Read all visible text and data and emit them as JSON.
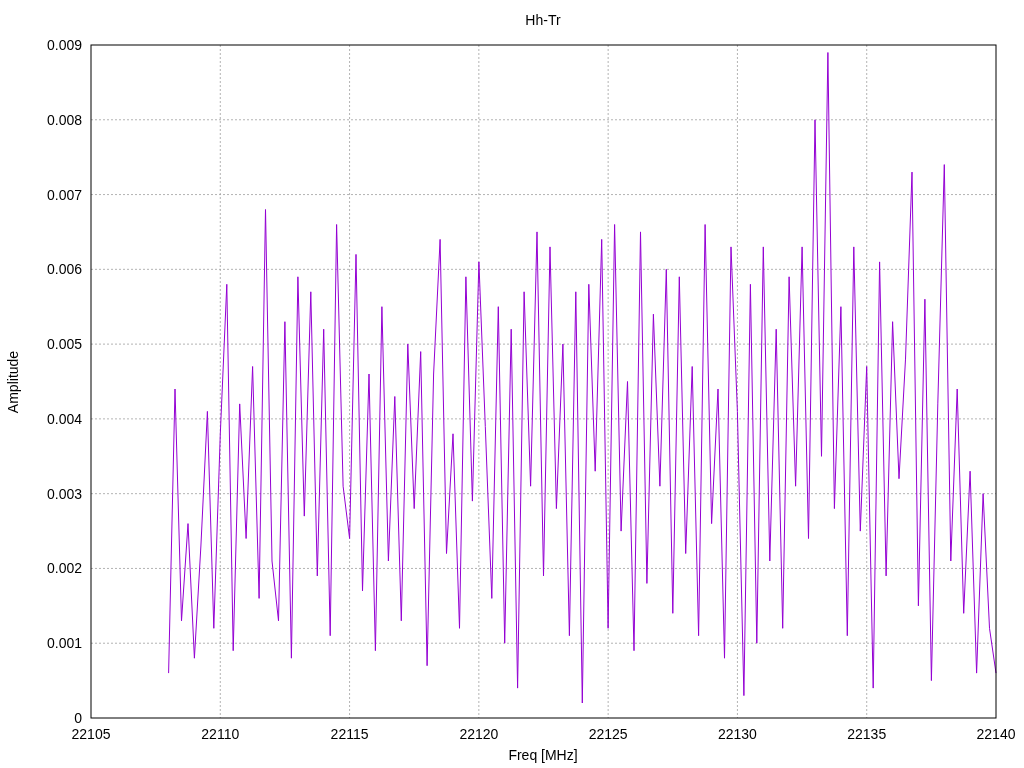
{
  "chart": {
    "chart_data": {
      "type": "line",
      "title": "Hh-Tr",
      "xlabel": "Freq [MHz]",
      "ylabel": "Amplitude",
      "grid": true,
      "xlim": [
        22105,
        22140
      ],
      "ylim": [
        0,
        0.009
      ],
      "xticks": [
        22105,
        22110,
        22115,
        22120,
        22125,
        22130,
        22135,
        22140
      ],
      "yticks": [
        0.009,
        0.008,
        0.007,
        0.006,
        0.005,
        0.004,
        0.003,
        0.002,
        0.001,
        0
      ],
      "x": [
        22108,
        22108.25,
        22108.5,
        22108.75,
        22109,
        22109.25,
        22109.5,
        22109.75,
        22110,
        22110.25,
        22110.5,
        22110.75,
        22111,
        22111.25,
        22111.5,
        22111.75,
        22112,
        22112.25,
        22112.5,
        22112.75,
        22113,
        22113.25,
        22113.5,
        22113.75,
        22114,
        22114.25,
        22114.5,
        22114.75,
        22115,
        22115.25,
        22115.5,
        22115.75,
        22116,
        22116.25,
        22116.5,
        22116.75,
        22117,
        22117.25,
        22117.5,
        22117.75,
        22118,
        22118.25,
        22118.5,
        22118.75,
        22119,
        22119.25,
        22119.5,
        22119.75,
        22120,
        22120.25,
        22120.5,
        22120.75,
        22121,
        22121.25,
        22121.5,
        22121.75,
        22122,
        22122.25,
        22122.5,
        22122.75,
        22123,
        22123.25,
        22123.5,
        22123.75,
        22124,
        22124.25,
        22124.5,
        22124.75,
        22125,
        22125.25,
        22125.5,
        22125.75,
        22126,
        22126.25,
        22126.5,
        22126.75,
        22127,
        22127.25,
        22127.5,
        22127.75,
        22128,
        22128.25,
        22128.5,
        22128.75,
        22129,
        22129.25,
        22129.5,
        22129.75,
        22130,
        22130.25,
        22130.5,
        22130.75,
        22131,
        22131.25,
        22131.5,
        22131.75,
        22132,
        22132.25,
        22132.5,
        22132.75,
        22133,
        22133.25,
        22133.5,
        22133.75,
        22134,
        22134.25,
        22134.5,
        22134.75,
        22135,
        22135.25,
        22135.5,
        22135.75,
        22136,
        22136.25,
        22136.5,
        22136.75,
        22137,
        22137.25,
        22137.5,
        22137.75,
        22138,
        22138.25,
        22138.5,
        22138.75,
        22139,
        22139.25,
        22139.5,
        22139.75,
        22140
      ],
      "series": [
        {
          "color": "#9400d3",
          "values": [
            0.0006,
            0.0044,
            0.0013,
            0.0026,
            0.0008,
            0.0023,
            0.0041,
            0.0012,
            0.0038,
            0.0058,
            0.0009,
            0.0042,
            0.0024,
            0.0047,
            0.0016,
            0.0068,
            0.0021,
            0.0013,
            0.0053,
            0.0008,
            0.0059,
            0.0027,
            0.0057,
            0.0019,
            0.0052,
            0.0011,
            0.0066,
            0.0031,
            0.0024,
            0.0062,
            0.0017,
            0.0046,
            0.0009,
            0.0055,
            0.0021,
            0.0043,
            0.0013,
            0.005,
            0.0028,
            0.0049,
            0.0007,
            0.0046,
            0.0064,
            0.0022,
            0.0038,
            0.0012,
            0.0059,
            0.0029,
            0.0061,
            0.0039,
            0.0016,
            0.0055,
            0.001,
            0.0052,
            0.0004,
            0.0057,
            0.0031,
            0.0065,
            0.0019,
            0.0063,
            0.0028,
            0.005,
            0.0011,
            0.0057,
            0.0002,
            0.0058,
            0.0033,
            0.0064,
            0.0012,
            0.0066,
            0.0025,
            0.0045,
            0.0009,
            0.0065,
            0.0018,
            0.0054,
            0.0031,
            0.006,
            0.0014,
            0.0059,
            0.0022,
            0.0047,
            0.0011,
            0.0066,
            0.0026,
            0.0044,
            0.0008,
            0.0063,
            0.0041,
            0.0003,
            0.0058,
            0.001,
            0.0063,
            0.0021,
            0.0052,
            0.0012,
            0.0059,
            0.0031,
            0.0063,
            0.0024,
            0.008,
            0.0035,
            0.0089,
            0.0028,
            0.0055,
            0.0011,
            0.0063,
            0.0025,
            0.0047,
            0.0004,
            0.0061,
            0.0019,
            0.0053,
            0.0032,
            0.0048,
            0.0073,
            0.0015,
            0.0056,
            0.0005,
            0.0042,
            0.0074,
            0.0021,
            0.0044,
            0.0014,
            0.0033,
            0.0006,
            0.003,
            0.0012,
            0.0006
          ]
        }
      ]
    }
  }
}
